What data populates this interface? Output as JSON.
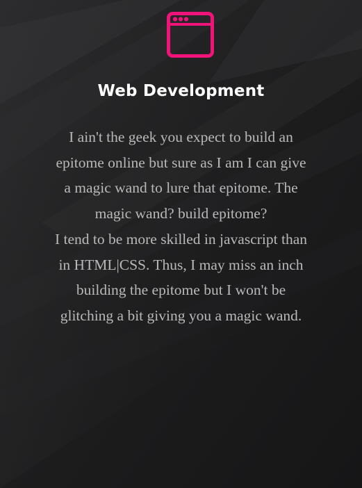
{
  "service": {
    "icon": "browser-window-icon",
    "accent_color": "#f0137a",
    "title": "Web Development",
    "description_lines": [
      "I ain't the geek you expect to build an",
      "epitome online but sure as I am I can give",
      "a magic wand to lure that epitome. The",
      "magic wand? build epitome?",
      "I tend to be more skilled in javascript than",
      "in HTML|CSS. Thus, I may miss an inch",
      "building the epitome but I won't be",
      "glitching a bit giving you a magic wand."
    ]
  }
}
